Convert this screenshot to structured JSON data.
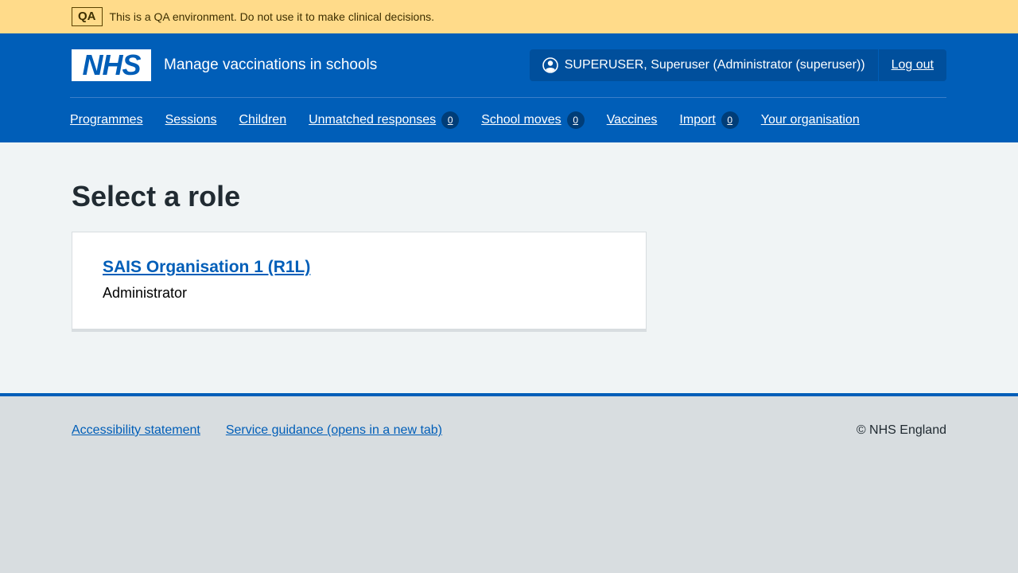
{
  "env_banner": {
    "tag": "QA",
    "text": "This is a QA environment. Do not use it to make clinical decisions."
  },
  "header": {
    "logo_text": "NHS",
    "service_name": "Manage vaccinations in schools",
    "account": {
      "user_label": "SUPERUSER, Superuser (Administrator (superuser))",
      "logout_label": "Log out"
    }
  },
  "nav": {
    "items": [
      {
        "label": "Programmes"
      },
      {
        "label": "Sessions"
      },
      {
        "label": "Children"
      },
      {
        "label": "Unmatched responses",
        "count": "0"
      },
      {
        "label": "School moves",
        "count": "0"
      },
      {
        "label": "Vaccines"
      },
      {
        "label": "Import",
        "count": "0"
      },
      {
        "label": "Your organisation"
      }
    ]
  },
  "main": {
    "title": "Select a role",
    "card": {
      "organisation": "SAIS Organisation 1 (R1L)",
      "role": "Administrator"
    }
  },
  "footer": {
    "links": [
      "Accessibility statement",
      "Service guidance (opens in a new tab)"
    ],
    "copyright": "© NHS England"
  },
  "colors": {
    "nhs_blue": "#005eb8",
    "banner_yellow": "#ffdb8a",
    "page_background": "#f0f4f5",
    "footer_background": "#d8dde0"
  }
}
